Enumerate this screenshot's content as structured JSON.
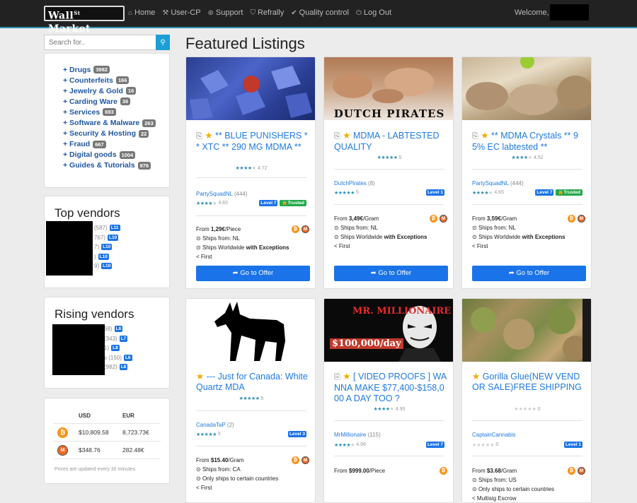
{
  "nav": {
    "brand": "Wall",
    "brand_sup": "St",
    "brand_tail": "Market",
    "items": [
      {
        "label": "Home",
        "icon": "home-icon"
      },
      {
        "label": "User-CP",
        "icon": "tools-icon"
      },
      {
        "label": "Support",
        "icon": "lifebuoy-icon"
      },
      {
        "label": "Refrally",
        "icon": "badge-icon"
      },
      {
        "label": "Quality control",
        "icon": "check-circle-icon"
      },
      {
        "label": "Log Out",
        "icon": "logout-icon"
      }
    ],
    "welcome": "Welcome,"
  },
  "search": {
    "placeholder": "Search for.."
  },
  "categories": [
    {
      "label": "+ Drugs",
      "count": "3982"
    },
    {
      "label": "+ Counterfeits",
      "count": "166"
    },
    {
      "label": "+ Jewelry & Gold",
      "count": "16"
    },
    {
      "label": "+ Carding Ware",
      "count": "36"
    },
    {
      "label": "+ Services",
      "count": "693"
    },
    {
      "label": "+ Software & Malware",
      "count": "263"
    },
    {
      "label": "+ Security & Hosting",
      "count": "22"
    },
    {
      "label": "+ Fraud",
      "count": "667"
    },
    {
      "label": "+ Digital goods",
      "count": "1004"
    },
    {
      "label": "+ Guides & Tutorials",
      "count": "976"
    }
  ],
  "top_vendors": {
    "title": "Top vendors",
    "rows": [
      {
        "count": "(587)",
        "level": "L11"
      },
      {
        "count": "767)",
        "level": "L10"
      },
      {
        "count": "7)",
        "level": "L10"
      },
      {
        "count": ")",
        "level": "L10"
      },
      {
        "count": "9)",
        "level": "L10"
      }
    ]
  },
  "rising_vendors": {
    "title": "Rising vendors",
    "rows": [
      {
        "count": "68)",
        "level": "L8"
      },
      {
        "count": "(343)",
        "level": "L7"
      },
      {
        "count": "1)",
        "level": "L8"
      },
      {
        "count": "s (150)",
        "level": "L6"
      },
      {
        "count": "(982)",
        "level": "L8"
      }
    ]
  },
  "prices": {
    "headers": [
      "USD",
      "EUR"
    ],
    "rows": [
      {
        "coin": "bitcoin-icon",
        "usd": "$10,809.58",
        "eur": "8,723.73€"
      },
      {
        "coin": "monero-icon",
        "usd": "$348.76",
        "eur": "282.48€"
      }
    ],
    "note": "Prices are updated every 30 minutes."
  },
  "featured": {
    "title": "Featured Listings",
    "button_label": "Go to Offer",
    "listings": [
      {
        "title": "** BLUE PUNISHERS ** XTC ** 290 MG MDMA **",
        "rating": "4.72",
        "vendor": "PartySquadNL",
        "vendor_count": "(444)",
        "vendor_rating": "4.65",
        "level": "Level 7",
        "trusted": "Trusted",
        "price": "1,29€",
        "unit": "/Piece",
        "ships_from": "NL",
        "ships_to_prefix": "Ships Worldwide",
        "ships_to_bold": "with Exceptions",
        "escrow": "First",
        "image_caption": ""
      },
      {
        "title": "MDMA - LABTESTED QUALITY",
        "rating": "5",
        "vendor": "DutchPirates",
        "vendor_count": "(8)",
        "vendor_rating": "5",
        "level": "Level 1",
        "trusted": "",
        "price": "3,49€",
        "unit": "/Gram",
        "ships_from": "NL",
        "ships_to_prefix": "Ships Worldwide",
        "ships_to_bold": "with Exceptions",
        "escrow": "First",
        "image_caption": "DUTCH PIRATES"
      },
      {
        "title": "** MDMA Crystals ** 95% EC labtested **",
        "rating": "4.52",
        "vendor": "PartySquadNL",
        "vendor_count": "(444)",
        "vendor_rating": "4.65",
        "level": "Level 7",
        "trusted": "Trusted",
        "price": "3,59€",
        "unit": "/Gram",
        "ships_from": "NL",
        "ships_to_prefix": "Ships Worldwide",
        "ships_to_bold": "with Exceptions",
        "escrow": "First",
        "image_caption": ""
      },
      {
        "title": "--- Just for Canada: White Quartz MDA",
        "rating": "5",
        "vendor": "CanadaTaP",
        "vendor_count": "(2)",
        "vendor_rating": "5",
        "level": "Level 3",
        "trusted": "",
        "price": "$15.40",
        "unit": "/Gram",
        "ships_from": "CA",
        "ships_to_prefix": "Only ships to certain countries",
        "ships_to_bold": "",
        "escrow": "First",
        "image_caption": ""
      },
      {
        "title": "[ VIDEO PROOFS ] WANNA MAKE $77,400-$158,000 A DAY TOO ?",
        "rating": "4.95",
        "vendor": "MrMillionaire",
        "vendor_count": "(115)",
        "vendor_rating": "4.96",
        "level": "Level 7",
        "trusted": "",
        "price": "$999.00",
        "unit": "/Piece",
        "ships_from": "",
        "ships_to_prefix": "",
        "ships_to_bold": "",
        "escrow": "",
        "image_caption": "MR. MILLIONAIRE",
        "image_caption2": "$100,000/day"
      },
      {
        "title": "Gorilla Glue(NEW VENDOR SALE)FREE SHIPPING",
        "rating": "0",
        "vendor": "CaptainCannabis",
        "vendor_count": "",
        "vendor_rating": "0",
        "level": "Level 1",
        "trusted": "",
        "price": "$3.68",
        "unit": "/Gram",
        "ships_from": "US",
        "ships_to_prefix": "Only ships to certain countries",
        "ships_to_bold": "",
        "escrow": "Multisig Escrow",
        "image_caption": ""
      }
    ]
  },
  "labels": {
    "from": "From",
    "ships_from": "Ships from:"
  },
  "colors": {
    "accent": "#1a73e8",
    "link": "#1f7ae0",
    "star": "#f0ad00",
    "trusted": "#22a94a",
    "nav": "#222222"
  }
}
